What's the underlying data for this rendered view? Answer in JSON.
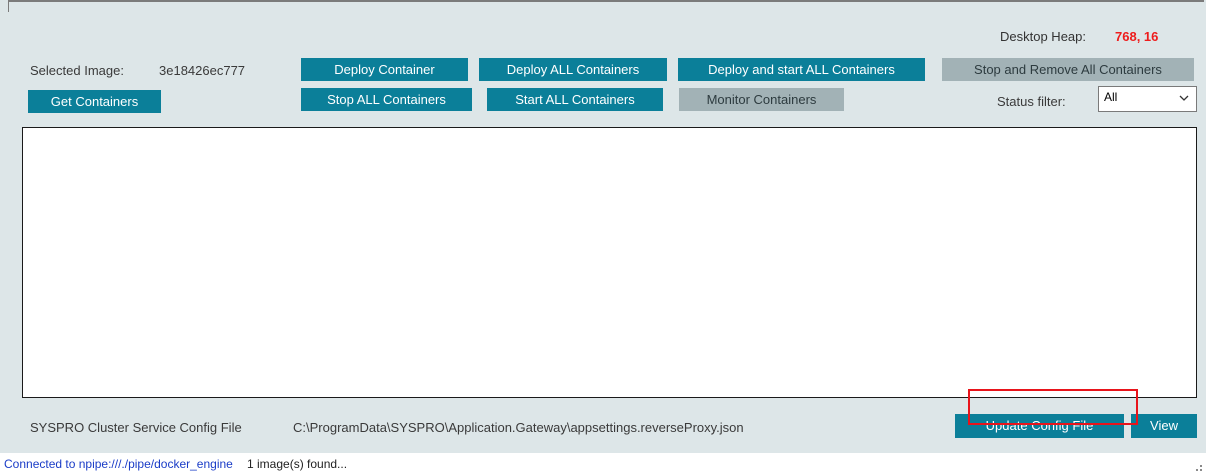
{
  "header": {
    "desktop_heap_label": "Desktop Heap:",
    "desktop_heap_value": "768, 16",
    "selected_image_label": "Selected Image:",
    "selected_image_value": "3e18426ec777"
  },
  "toolbar": {
    "get_containers": "Get Containers",
    "deploy_container": "Deploy Container",
    "deploy_all": "Deploy ALL Containers",
    "deploy_start_all": "Deploy and start ALL Containers",
    "stop_remove_all": "Stop and Remove All Containers",
    "stop_all": "Stop ALL Containers",
    "start_all": "Start ALL Containers",
    "monitor": "Monitor Containers"
  },
  "filter": {
    "label": "Status filter:",
    "value": "All"
  },
  "footer": {
    "config_label": "SYSPRO Cluster Service Config File",
    "config_path": "C:\\ProgramData\\SYSPRO\\Application.Gateway\\appsettings.reverseProxy.json",
    "update_button": "Update Config File",
    "view_button": "View"
  },
  "status": {
    "connection": "Connected to npipe:///./pipe/docker_engine",
    "message": "1 image(s) found..."
  },
  "colors": {
    "accent": "#0b7f99",
    "disabled": "#a2b2b6",
    "heap_value": "#ee1c1c",
    "highlight": "#e8141b",
    "panel": "#dde6e8"
  }
}
